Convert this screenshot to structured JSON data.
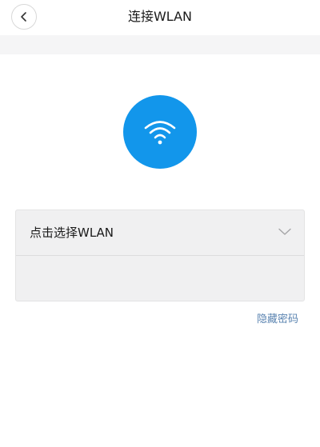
{
  "header": {
    "title": "连接WLAN",
    "back_icon": "chevron-left-icon"
  },
  "hero": {
    "icon": "wifi-icon",
    "color": "#1296eb"
  },
  "form": {
    "wlan_select_label": "点击选择WLAN",
    "wlan_select_icon": "chevron-down-icon",
    "password_value": ""
  },
  "actions": {
    "hide_password_label": "隐藏密码",
    "link_color": "#5b84b1"
  }
}
